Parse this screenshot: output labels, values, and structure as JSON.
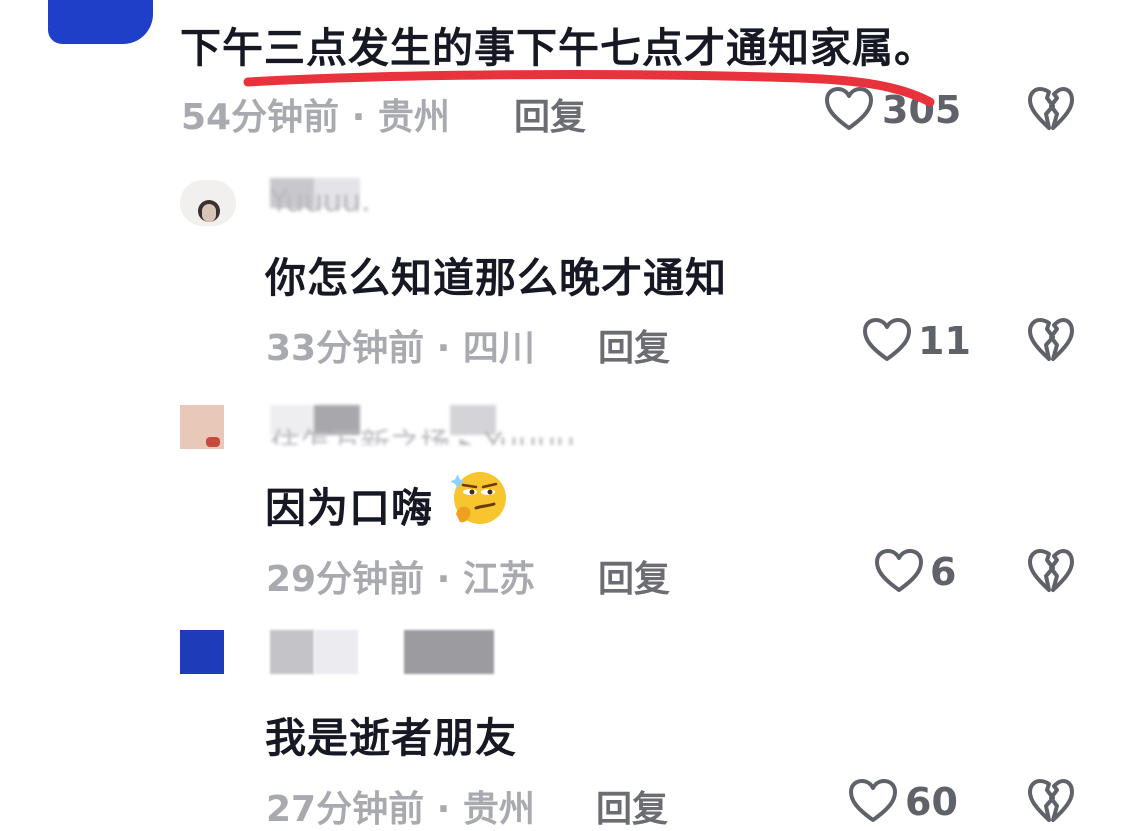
{
  "colors": {
    "text_primary": "#161823",
    "text_meta": "#a8aab0",
    "text_reply": "#6b6d73",
    "underline_red": "#e8323c",
    "avatar_blue": "#1f3fc8"
  },
  "top_comment": {
    "text": "下午三点发生的事下午七点才通知家属。",
    "time_location": "54分钟前 · 贵州",
    "reply_label": "回复",
    "like_count": "305"
  },
  "replies": [
    {
      "username_fragment": "Yuuuu.",
      "text": "你怎么知道那么晚才通知",
      "time_location": "33分钟前 · 四川",
      "reply_label": "回复",
      "like_count": "11"
    },
    {
      "username_fragment": "住怎万新之场 ▸ Yuuuu.",
      "text": "因为口嗨",
      "emoji": "smirk-thinking-emoji",
      "time_location": "29分钟前 · 江苏",
      "reply_label": "回复",
      "like_count": "6"
    },
    {
      "username_fragment": "",
      "text": "我是逝者朋友",
      "time_location": "27分钟前 · 贵州",
      "reply_label": "回复",
      "like_count": "60"
    }
  ],
  "icons": {
    "like": "heart-outline-icon",
    "dislike": "broken-heart-icon"
  }
}
